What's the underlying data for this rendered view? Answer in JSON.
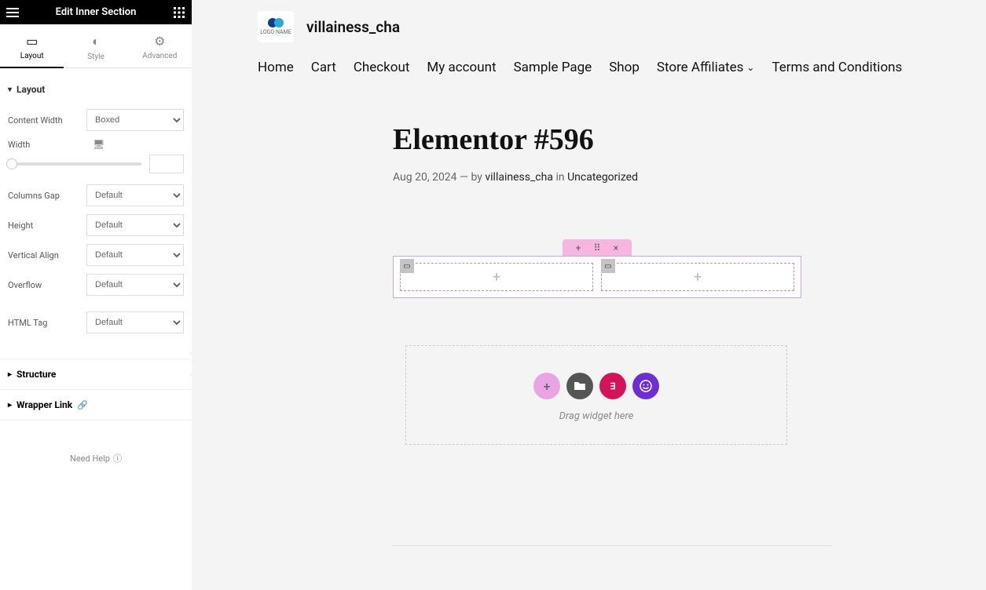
{
  "header": {
    "title": "Edit Inner Section"
  },
  "tabs": [
    {
      "label": "Layout"
    },
    {
      "label": "Style"
    },
    {
      "label": "Advanced"
    }
  ],
  "layout": {
    "section_title": "Layout",
    "content_width_label": "Content Width",
    "content_width_value": "Boxed",
    "width_label": "Width",
    "columns_gap_label": "Columns Gap",
    "columns_gap_value": "Default",
    "height_label": "Height",
    "height_value": "Default",
    "valign_label": "Vertical Align",
    "valign_value": "Default",
    "overflow_label": "Overflow",
    "overflow_value": "Default",
    "htmltag_label": "HTML Tag",
    "htmltag_value": "Default"
  },
  "collapsibles": {
    "structure": "Structure",
    "wrapper_link": "Wrapper Link"
  },
  "help": "Need Help",
  "site": {
    "title": "villainess_cha",
    "logo_text": "LOGO NAME",
    "menu": [
      "Home",
      "Cart",
      "Checkout",
      "My account",
      "Sample Page",
      "Shop",
      "Store Affiliates",
      "Terms and Conditions"
    ]
  },
  "post": {
    "title": "Elementor #596",
    "date": "Aug 20, 2024",
    "sep": "—",
    "by_prefix": "by",
    "author": "villainess_cha",
    "in_prefix": "in",
    "category": "Uncategorized"
  },
  "inner_section": {
    "add_label": "+",
    "drag_label": "⠿",
    "close_label": "×",
    "col_add": "+"
  },
  "dropzone": {
    "text": "Drag widget here",
    "buttons": {
      "add": "+",
      "folder": "📁",
      "ek": "∃K",
      "smile": "☺"
    }
  }
}
